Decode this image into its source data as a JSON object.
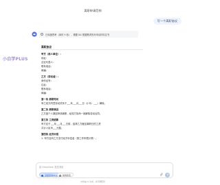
{
  "header": {
    "title": "离职申请范例"
  },
  "user_message": "写一个离职协议",
  "ai": {
    "thinking_text": "已深度思考（用时 9 秒），需要 BX 根据需求的写申请材料文书"
  },
  "watermark": "小白学PLUS",
  "doc": {
    "title": "离职协议",
    "party_a_label": "甲方（用人单位）：",
    "party_a_fields": [
      "地址：",
      "法定代表人：",
      "联系电话：",
      "邮编："
    ],
    "party_b_label": "乙方（劳动者）：",
    "party_b_fields": [
      "身份证号：",
      "住址：",
      "联系电话：",
      "邮编："
    ],
    "sec1_title": "第一条 离职时间",
    "sec1_text": "甲乙双方同意劳动关系于___年___月___日（小写：___）解除。",
    "sec2_title": "第二条 离职原因",
    "sec2_text": "乙方因个人原因申请离职，经双方协商一致解除劳动合同。",
    "sec3_title": "第三条 工资结算",
    "sec3_text_1": "甲方应于___年___月___日前，结清乙方截至离职日的工资",
    "sec3_text_2": "共计人民币___元整。",
    "sec4_title": "第四条 经济补偿",
    "sec4_text": "1. 甲方应向乙方支付经济补偿金（按工作年限计算）。"
  },
  "input": {
    "placeholder": "给 DeepSeek 发送消息",
    "deep_think_label": "深度思考(R1)",
    "web_search_label": "联网搜索"
  },
  "footer": "内容由 AI 生成，请仔细甄别",
  "colors": {
    "accent": "#2a62d8",
    "watermark": "#a58be0"
  }
}
